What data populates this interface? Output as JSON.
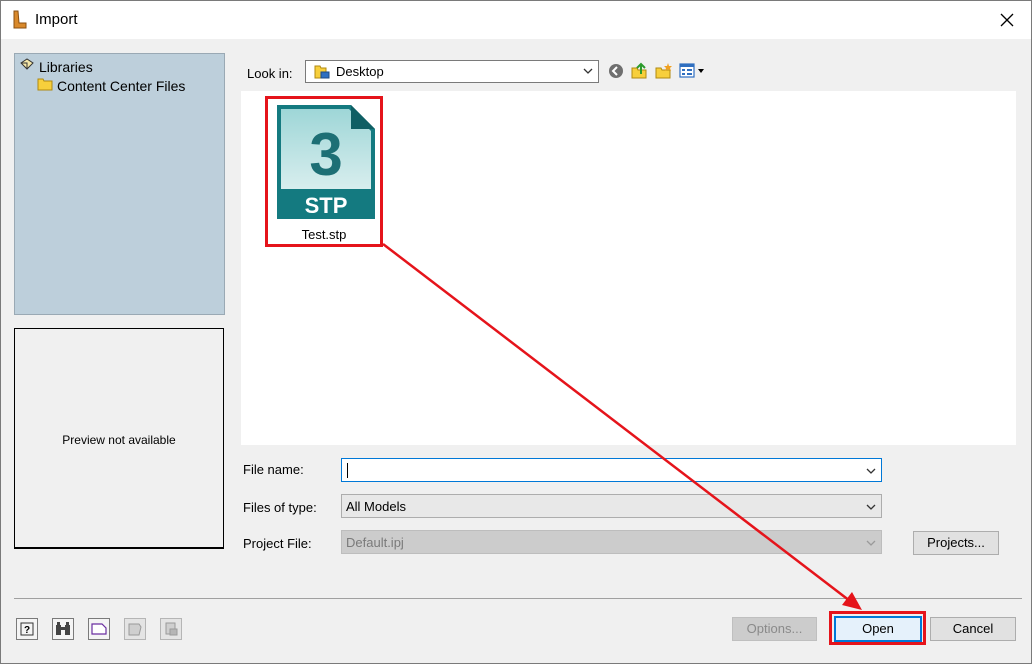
{
  "window": {
    "title": "Import"
  },
  "libraries": {
    "root_label": "Libraries",
    "items": [
      {
        "label": "Content Center Files"
      }
    ]
  },
  "preview": {
    "text": "Preview not available"
  },
  "look_in": {
    "label": "Look in:",
    "value": "Desktop"
  },
  "files": [
    {
      "name": "Test.stp",
      "icon_text": "STP",
      "icon_digit": "3"
    }
  ],
  "form": {
    "file_name_label": "File name:",
    "file_name_value": "",
    "files_of_type_label": "Files of type:",
    "files_of_type_value": "All Models",
    "project_file_label": "Project File:",
    "project_file_value": "Default.ipj"
  },
  "buttons": {
    "projects": "Projects...",
    "options": "Options...",
    "open": "Open",
    "cancel": "Cancel"
  },
  "colors": {
    "highlight": "#e5141b",
    "focus": "#0078d7",
    "library_bg": "#bdcfdb",
    "stp_teal": "#1a7f86"
  }
}
